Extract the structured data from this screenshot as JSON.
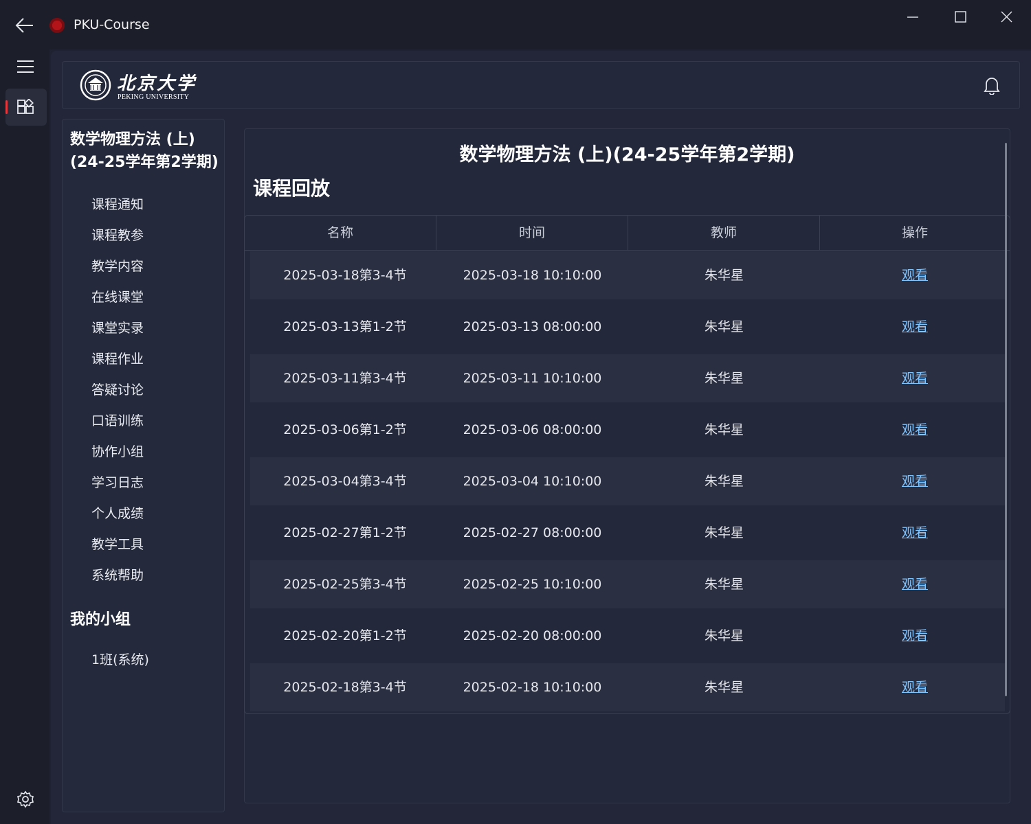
{
  "window": {
    "title": "PKU-Course",
    "controls": [
      "minimize",
      "maximize",
      "close"
    ]
  },
  "nav": {
    "items": [
      {
        "icon": "menu-icon"
      },
      {
        "icon": "apps-icon",
        "active": true
      }
    ],
    "bottom_icon": "settings-icon"
  },
  "header": {
    "logo_cn": "北京大学",
    "logo_en": "PEKING UNIVERSITY",
    "notification_icon": "bell-icon"
  },
  "sidebar": {
    "course_title": "数学物理方法 (上)(24-25学年第2学期)",
    "menu": [
      "课程通知",
      "课程教参",
      "教学内容",
      "在线课堂",
      "课堂实录",
      "课程作业",
      "答疑讨论",
      "口语训练",
      "协作小组",
      "学习日志",
      "个人成绩",
      "教学工具",
      "系统帮助"
    ],
    "group_title": "我的小组",
    "groups": [
      "1班(系统)"
    ]
  },
  "main": {
    "page_title": "数学物理方法 (上)(24-25学年第2学期)",
    "section_title": "课程回放",
    "table": {
      "headers": [
        "名称",
        "时间",
        "教师",
        "操作"
      ],
      "rows": [
        {
          "name": "2025-03-18第3-4节",
          "time": "2025-03-18 10:10:00",
          "teacher": "朱华星",
          "action": "观看"
        },
        {
          "name": "2025-03-13第1-2节",
          "time": "2025-03-13 08:00:00",
          "teacher": "朱华星",
          "action": "观看"
        },
        {
          "name": "2025-03-11第3-4节",
          "time": "2025-03-11 10:10:00",
          "teacher": "朱华星",
          "action": "观看"
        },
        {
          "name": "2025-03-06第1-2节",
          "time": "2025-03-06 08:00:00",
          "teacher": "朱华星",
          "action": "观看"
        },
        {
          "name": "2025-03-04第3-4节",
          "time": "2025-03-04 10:10:00",
          "teacher": "朱华星",
          "action": "观看"
        },
        {
          "name": "2025-02-27第1-2节",
          "time": "2025-02-27 08:00:00",
          "teacher": "朱华星",
          "action": "观看"
        },
        {
          "name": "2025-02-25第3-4节",
          "time": "2025-02-25 10:10:00",
          "teacher": "朱华星",
          "action": "观看"
        },
        {
          "name": "2025-02-20第1-2节",
          "time": "2025-02-20 08:00:00",
          "teacher": "朱华星",
          "action": "观看"
        },
        {
          "name": "2025-02-18第3-4节",
          "time": "2025-02-18 10:10:00",
          "teacher": "朱华星",
          "action": "观看"
        }
      ]
    }
  },
  "colors": {
    "accent": "#e0393e",
    "link": "#7fc3ff",
    "background": "#222638"
  }
}
